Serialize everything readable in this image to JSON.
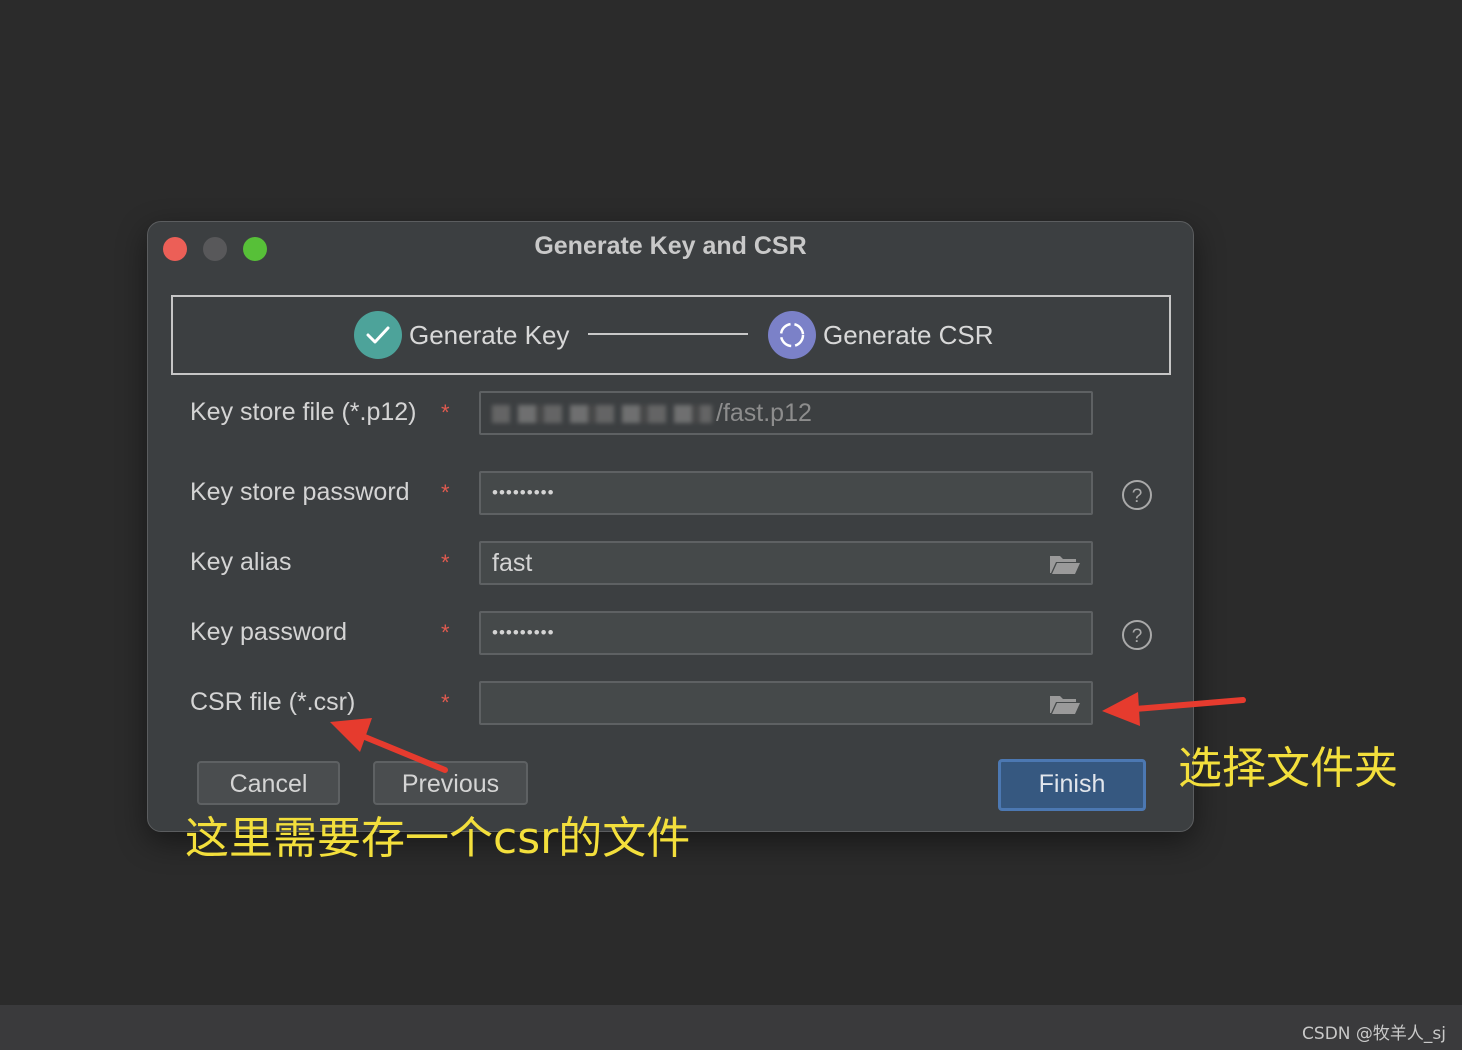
{
  "window": {
    "title": "Generate Key and CSR"
  },
  "steps": [
    {
      "label": "Generate Key",
      "state": "done"
    },
    {
      "label": "Generate CSR",
      "state": "active"
    }
  ],
  "form": {
    "keystore_file": {
      "label": "Key store file (*.p12)",
      "required": "*",
      "value": "/fast.p12"
    },
    "keystore_password": {
      "label": "Key store password",
      "required": "*",
      "value": "•••••••••"
    },
    "key_alias": {
      "label": "Key alias",
      "required": "*",
      "value": "fast"
    },
    "key_password": {
      "label": "Key password",
      "required": "*",
      "value": "•••••••••"
    },
    "csr_file": {
      "label": "CSR file (*.csr)",
      "required": "*",
      "value": ""
    }
  },
  "buttons": {
    "cancel": "Cancel",
    "previous": "Previous",
    "finish": "Finish"
  },
  "annotations": {
    "csr_note": "这里需要存一个csr的文件",
    "folder_note": "选择文件夹"
  },
  "watermark": "CSDN @牧羊人_sj",
  "colors": {
    "background": "#2b2b2b",
    "dialog": "#3c3f41",
    "step_done": "#4da39a",
    "step_active": "#7b81c8",
    "required": "#e05a4f",
    "finish_button": "#365880",
    "annotation_text": "#f3df3c",
    "annotation_arrow": "#e63b2e"
  }
}
